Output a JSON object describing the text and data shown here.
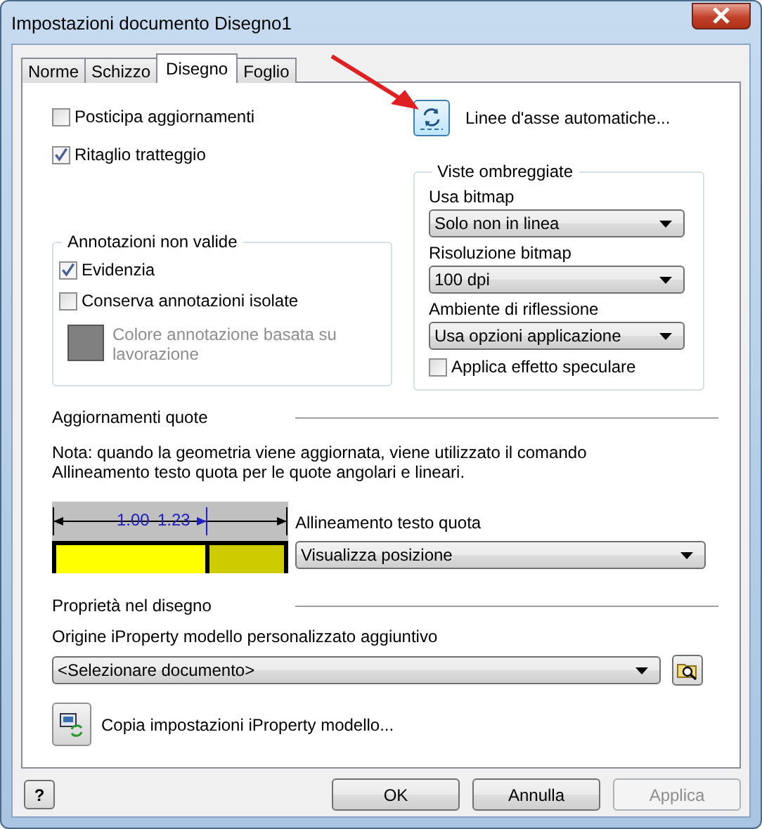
{
  "window": {
    "title": "Impostazioni documento Disegno1"
  },
  "tabs": [
    {
      "label": "Norme",
      "selected": false
    },
    {
      "label": "Schizzo",
      "selected": false
    },
    {
      "label": "Disegno",
      "selected": true
    },
    {
      "label": "Foglio",
      "selected": false
    }
  ],
  "options": [
    {
      "label": "Posticipa aggiornamenti",
      "checked": false
    },
    {
      "label": "Ritaglio tratteggio",
      "checked": true
    }
  ],
  "centerlines_button": {
    "label": "Linee d'asse automatiche..."
  },
  "invalid_annotations": {
    "title": "Annotazioni non valide",
    "options": [
      {
        "label": "Evidenzia",
        "checked": true
      },
      {
        "label": "Conserva annotazioni isolate",
        "checked": false
      }
    ],
    "color_label": "Colore annotazione basata su lavorazione",
    "color_disabled": true
  },
  "shaded_views": {
    "title": "Viste ombreggiate",
    "fields": [
      {
        "label": "Usa bitmap",
        "value": "Solo non in linea"
      },
      {
        "label": "Risoluzione bitmap",
        "value": "100 dpi"
      },
      {
        "label": "Ambiente di riflessione",
        "value": "Usa opzioni applicazione"
      }
    ],
    "specular": {
      "label": "Applica effetto speculare",
      "checked": false
    }
  },
  "dimension_updates": {
    "title": "Aggiornamenti quote",
    "note": "Nota: quando la geometria viene aggiornata, viene utilizzato il comando Allineamento testo quota per le quote angolari e lineari.",
    "preview_values": [
      "1.00",
      "1.23"
    ],
    "alignment": {
      "label": "Allineamento testo quota",
      "value": "Visualizza posizione"
    }
  },
  "drawing_properties": {
    "title": "Proprietà nel disegno",
    "source_label": "Origine iProperty modello personalizzato aggiuntivo",
    "source_value": "<Selezionare documento>",
    "copy_label": "Copia impostazioni iProperty modello..."
  },
  "help_icon": "?",
  "buttons": [
    {
      "label": "OK",
      "disabled": false
    },
    {
      "label": "Annulla",
      "disabled": false
    },
    {
      "label": "Applica",
      "disabled": true
    }
  ]
}
